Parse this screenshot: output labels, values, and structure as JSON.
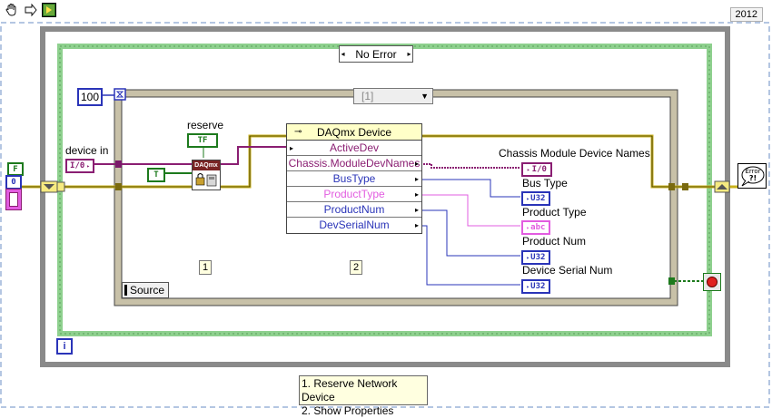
{
  "toolbar": {
    "icons": [
      "hand-icon",
      "run-arrow-icon",
      "highlight-execution-icon"
    ],
    "version": "2012"
  },
  "case_structure": {
    "selector": "No Error"
  },
  "sequence": {
    "selector": "[1]",
    "frame_labels": [
      "1",
      "2"
    ],
    "source_label": "Source"
  },
  "constants": {
    "timeout": "100"
  },
  "labels": {
    "device_in": "device in",
    "reserve": "reserve",
    "chassis_names": "Chassis Module Device Names",
    "bus_type": "Bus Type",
    "product_type": "Product Type",
    "product_num": "Product Num",
    "serial_num": "Device Serial Num"
  },
  "terminals": {
    "io": "I/0",
    "u32": "U32",
    "abc": "abc",
    "tf": "TF",
    "t": "T",
    "f": "F",
    "zero": "0",
    "info": "i",
    "daqmx": "DAQmx",
    "error": "Error"
  },
  "property_node": {
    "title": "DAQmx Device",
    "rows": [
      "ActiveDev",
      "Chassis.ModuleDevNames",
      "BusType",
      "ProductType",
      "ProductNum",
      "DevSerialNum"
    ]
  },
  "comment": [
    "1. Reserve Network Device",
    "2. Show Properties"
  ],
  "colors": {
    "wire_error": "#c9b21c",
    "wire_devname": "#8a1e72",
    "wire_u32": "#2a34b8",
    "wire_string": "#e25ce0",
    "wire_bool": "#1d7a1d",
    "while_loop": "#808080",
    "case_border": "#7fcf7f"
  }
}
